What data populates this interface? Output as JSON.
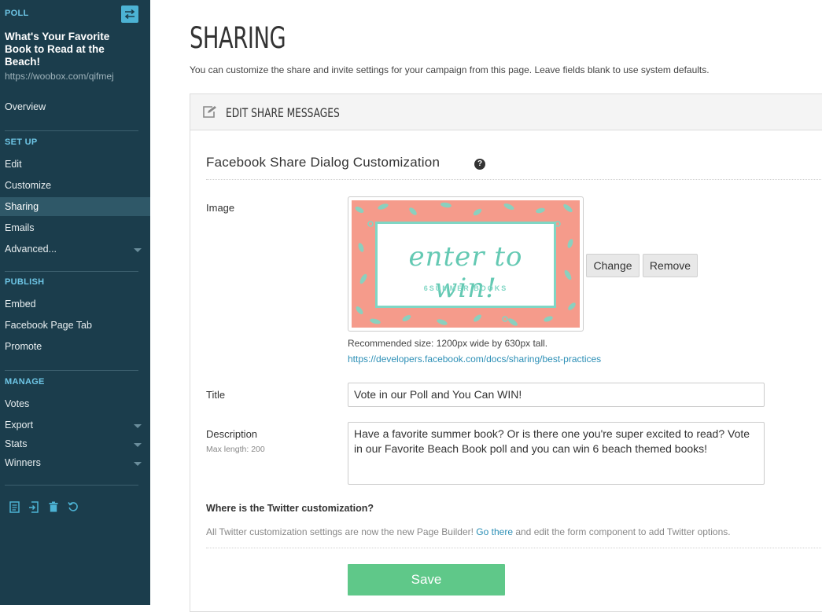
{
  "sidebar": {
    "type_label": "POLL",
    "campaign_title": "What's Your Favorite Book to Read at the Beach!",
    "campaign_url": "https://woobox.com/qifmej",
    "overview": "Overview",
    "setup_heading": "SET UP",
    "setup_items": [
      "Edit",
      "Customize",
      "Sharing",
      "Emails",
      "Advanced..."
    ],
    "publish_heading": "PUBLISH",
    "publish_items": [
      "Embed",
      "Facebook Page Tab",
      "Promote"
    ],
    "manage_heading": "MANAGE",
    "manage_items": [
      "Votes",
      "Export",
      "Stats",
      "Winners"
    ],
    "active_item": "Sharing",
    "tool_icons": [
      "page-icon",
      "import-icon",
      "trash-icon",
      "reset-icon"
    ]
  },
  "header": {
    "title": "SHARING",
    "description": "You can customize the share and invite settings for your campaign from this page. Leave fields blank to use system defaults."
  },
  "panel": {
    "title": "EDIT SHARE MESSAGES",
    "section_title": "Facebook Share Dialog Customization",
    "image_label": "Image",
    "image_text_main": "enter to win!",
    "image_text_sub": "6SUMMER BOOKS",
    "change_button": "Change",
    "remove_button": "Remove",
    "recommended_size": "Recommended size: 1200px wide by 630px tall.",
    "best_practices_link": "https://developers.facebook.com/docs/sharing/best-practices",
    "title_label": "Title",
    "title_value": "Vote in our Poll and You Can WIN!",
    "description_label": "Description",
    "description_hint": "Max length: 200",
    "description_value": "Have a favorite summer book? Or is there one you're super excited to read? Vote in our Favorite Beach Book poll and you can win 6 beach themed books!",
    "twitter_question": "Where is the Twitter customization?",
    "twitter_text_before": "All Twitter customization settings are now the new Page Builder! ",
    "twitter_link": "Go there",
    "twitter_text_after": " and edit the form component to add Twitter options.",
    "save_button": "Save"
  },
  "colors": {
    "sidebar_bg": "#1b3d4c",
    "sidebar_active": "#2f5868",
    "accent": "#4cb3d4",
    "save_green": "#5fc889",
    "link": "#2c8fb6"
  }
}
